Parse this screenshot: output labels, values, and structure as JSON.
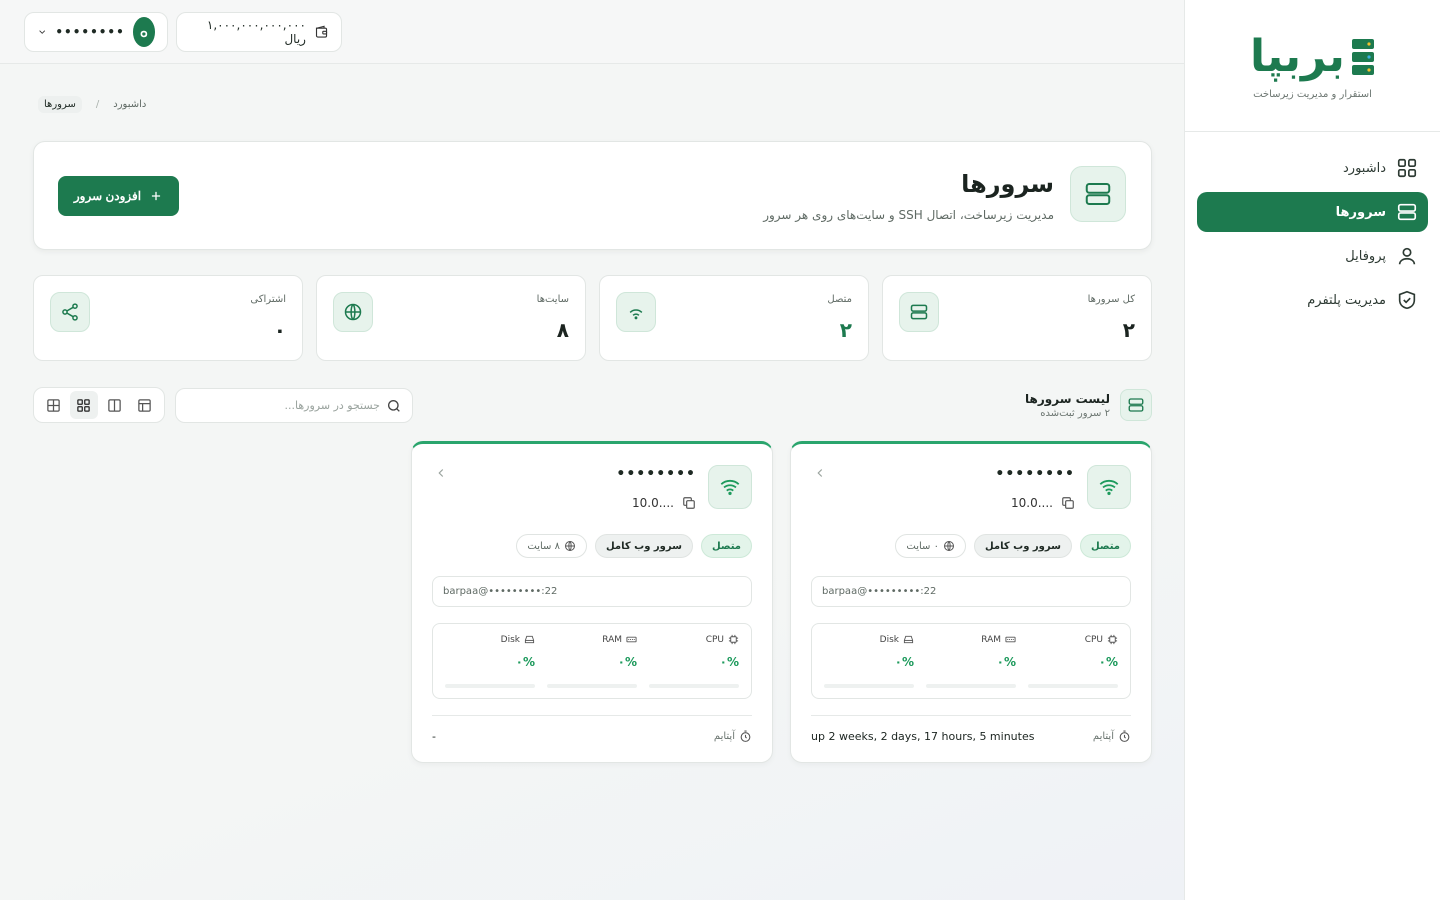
{
  "sidebar": {
    "logo_text": "بربپا",
    "logo_sub": "استقرار و مدیریت زیرساخت",
    "items": [
      {
        "label": "داشبورد",
        "icon": "grid-icon"
      },
      {
        "label": "سرورها",
        "icon": "server-icon"
      },
      {
        "label": "پروفایل",
        "icon": "user-icon"
      },
      {
        "label": "مدیریت پلتفرم",
        "icon": "shield-icon"
      }
    ]
  },
  "topbar": {
    "user_name": "••••••••",
    "avatar_initial": "๐",
    "wallet": "۱,۰۰۰,۰۰۰,۰۰۰,۰۰۰ ریال"
  },
  "breadcrumb": {
    "home": "داشبورد",
    "sep": "/",
    "current": "سرورها"
  },
  "header": {
    "title": "سرورها",
    "desc": "مدیریت زیرساخت، اتصال SSH و سایت‌های روی هر سرور",
    "add_button": "افزودن سرور"
  },
  "stats": [
    {
      "label": "کل سرورها",
      "value": "۲"
    },
    {
      "label": "متصل",
      "value": "۲"
    },
    {
      "label": "سایت‌ها",
      "value": "۸"
    },
    {
      "label": "اشتراکی",
      "value": "۰"
    }
  ],
  "list": {
    "title": "لیست سرورها",
    "subtitle": "۲ سرور ثبت‌شده",
    "search_placeholder": "جستجو در سرورها..."
  },
  "servers": [
    {
      "name": "••••••••",
      "ip": "10.0....",
      "status": "متصل",
      "type": "سرور وب کامل",
      "sites": "۰ سایت",
      "ssh": "barpaa@•••••••••:22",
      "metrics": [
        {
          "label": "CPU",
          "value": "۰%"
        },
        {
          "label": "RAM",
          "value": "۰%"
        },
        {
          "label": "Disk",
          "value": "۰%"
        }
      ],
      "uptime_label": "آپتایم",
      "uptime": "up 2 weeks, 2 days, 17 hours, 5 minutes"
    },
    {
      "name": "••••••••",
      "ip": "10.0....",
      "status": "متصل",
      "type": "سرور وب کامل",
      "sites": "۸ سایت",
      "ssh": "barpaa@•••••••••:22",
      "metrics": [
        {
          "label": "CPU",
          "value": "۰%"
        },
        {
          "label": "RAM",
          "value": "۰%"
        },
        {
          "label": "Disk",
          "value": "۰%"
        }
      ],
      "uptime_label": "آپتایم",
      "uptime": "-"
    }
  ],
  "colors": {
    "accent": "#1d7a4f",
    "accent_light": "#e7f3ec",
    "success": "#1d9a5c"
  }
}
